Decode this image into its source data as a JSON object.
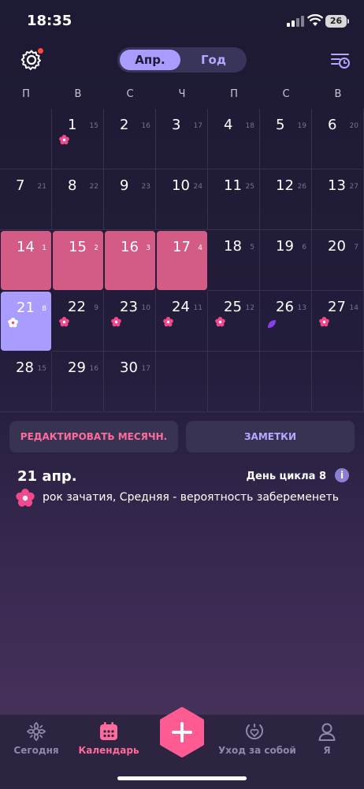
{
  "status": {
    "time": "18:35",
    "battery": "26"
  },
  "header": {
    "month_tab": "Апр.",
    "year_tab": "Год"
  },
  "weekdays": [
    "П",
    "В",
    "С",
    "Ч",
    "П",
    "С",
    "В"
  ],
  "calendar": {
    "weeks": [
      [
        null,
        {
          "d": "1",
          "c": "15",
          "flower": true
        },
        {
          "d": "2",
          "c": "16"
        },
        {
          "d": "3",
          "c": "17"
        },
        {
          "d": "4",
          "c": "18"
        },
        {
          "d": "5",
          "c": "19"
        },
        {
          "d": "6",
          "c": "20"
        }
      ],
      [
        {
          "d": "7",
          "c": "21"
        },
        {
          "d": "8",
          "c": "22"
        },
        {
          "d": "9",
          "c": "23"
        },
        {
          "d": "10",
          "c": "24"
        },
        {
          "d": "11",
          "c": "25"
        },
        {
          "d": "12",
          "c": "26"
        },
        {
          "d": "13",
          "c": "27"
        }
      ],
      [
        {
          "d": "14",
          "c": "1",
          "period": true
        },
        {
          "d": "15",
          "c": "2",
          "period": true
        },
        {
          "d": "16",
          "c": "3",
          "period": true
        },
        {
          "d": "17",
          "c": "4",
          "period": true
        },
        {
          "d": "18",
          "c": "5"
        },
        {
          "d": "19",
          "c": "6"
        },
        {
          "d": "20",
          "c": "7"
        }
      ],
      [
        {
          "d": "21",
          "c": "8",
          "today": true,
          "flower": true
        },
        {
          "d": "22",
          "c": "9",
          "flower": true
        },
        {
          "d": "23",
          "c": "10",
          "flower": true
        },
        {
          "d": "24",
          "c": "11",
          "flower": true
        },
        {
          "d": "25",
          "c": "12",
          "flower": true
        },
        {
          "d": "26",
          "c": "13",
          "leaf": true
        },
        {
          "d": "27",
          "c": "14",
          "flower": true
        }
      ],
      [
        {
          "d": "28",
          "c": "15"
        },
        {
          "d": "29",
          "c": "16"
        },
        {
          "d": "30",
          "c": "17"
        },
        null,
        null,
        null,
        null
      ]
    ]
  },
  "actions": {
    "edit": "РЕДАКТИРОВАТЬ МЕСЯЧН.",
    "notes": "ЗАМЕТКИ"
  },
  "info": {
    "date": "21 апр.",
    "cycle_day": "День цикла 8",
    "text": "рок зачатия, Средняя - вероятность забеременеть"
  },
  "tabs": [
    {
      "label": "Сегодня",
      "icon": "flower-outline-icon"
    },
    {
      "label": "Календарь",
      "icon": "calendar-icon"
    },
    {
      "label": "Уход за собой",
      "icon": "self-care-icon"
    },
    {
      "label": "Я",
      "icon": "person-icon"
    }
  ],
  "colors": {
    "period": "#d35b86",
    "today": "#a99cff",
    "accent": "#ff6b9b"
  }
}
